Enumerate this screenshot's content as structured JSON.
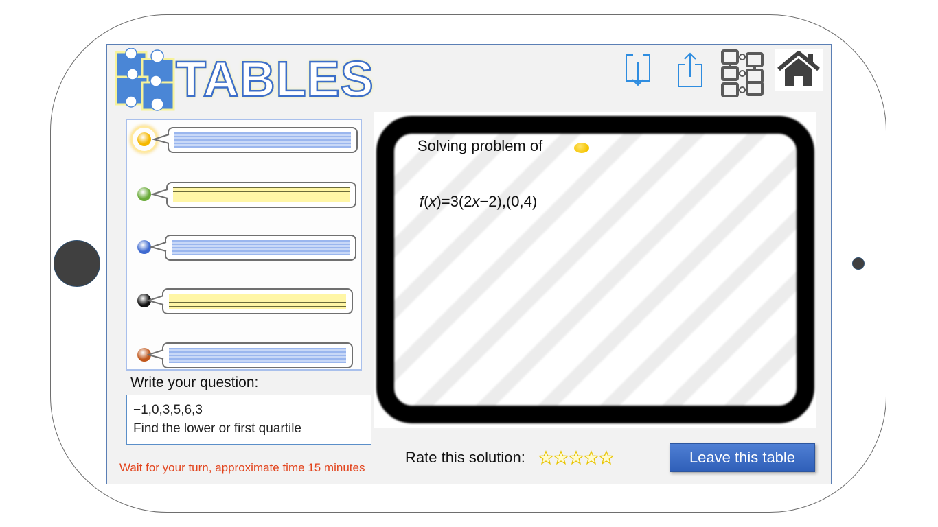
{
  "app": {
    "logo_text": "TABLES"
  },
  "toolbar": {
    "icons": [
      "download-icon",
      "share-icon",
      "sitemap-icon",
      "home-icon"
    ]
  },
  "chat": {
    "messages": [
      {
        "color": "#f5b800",
        "bubble_color": "blue",
        "highlighted": true
      },
      {
        "color": "#6aab3a",
        "bubble_color": "yellow"
      },
      {
        "color": "#3f6ad0",
        "bubble_color": "blue"
      },
      {
        "color": "#111111",
        "bubble_color": "yellow"
      },
      {
        "color": "#c0571c",
        "bubble_color": "blue"
      }
    ]
  },
  "question": {
    "label": "Write your question:",
    "line1": "−1,0,3,5,6,3",
    "line2": "Find the lower or first quartile"
  },
  "status": {
    "wait_text": "Wait for your turn, approximate time 15 minutes"
  },
  "board": {
    "title": "Solving problem of",
    "formula_f": "f",
    "formula_open": "(",
    "formula_x": "x",
    "formula_mid": ")=3(2",
    "formula_x2": "x",
    "formula_end": "−2),(0,4)",
    "solver_color": "#f5c400"
  },
  "rating": {
    "label": "Rate this solution:",
    "max_stars": 5,
    "value": 0
  },
  "actions": {
    "leave_label": "Leave this table"
  },
  "colors": {
    "accent": "#3d6fc9",
    "warning": "#e2431c"
  }
}
